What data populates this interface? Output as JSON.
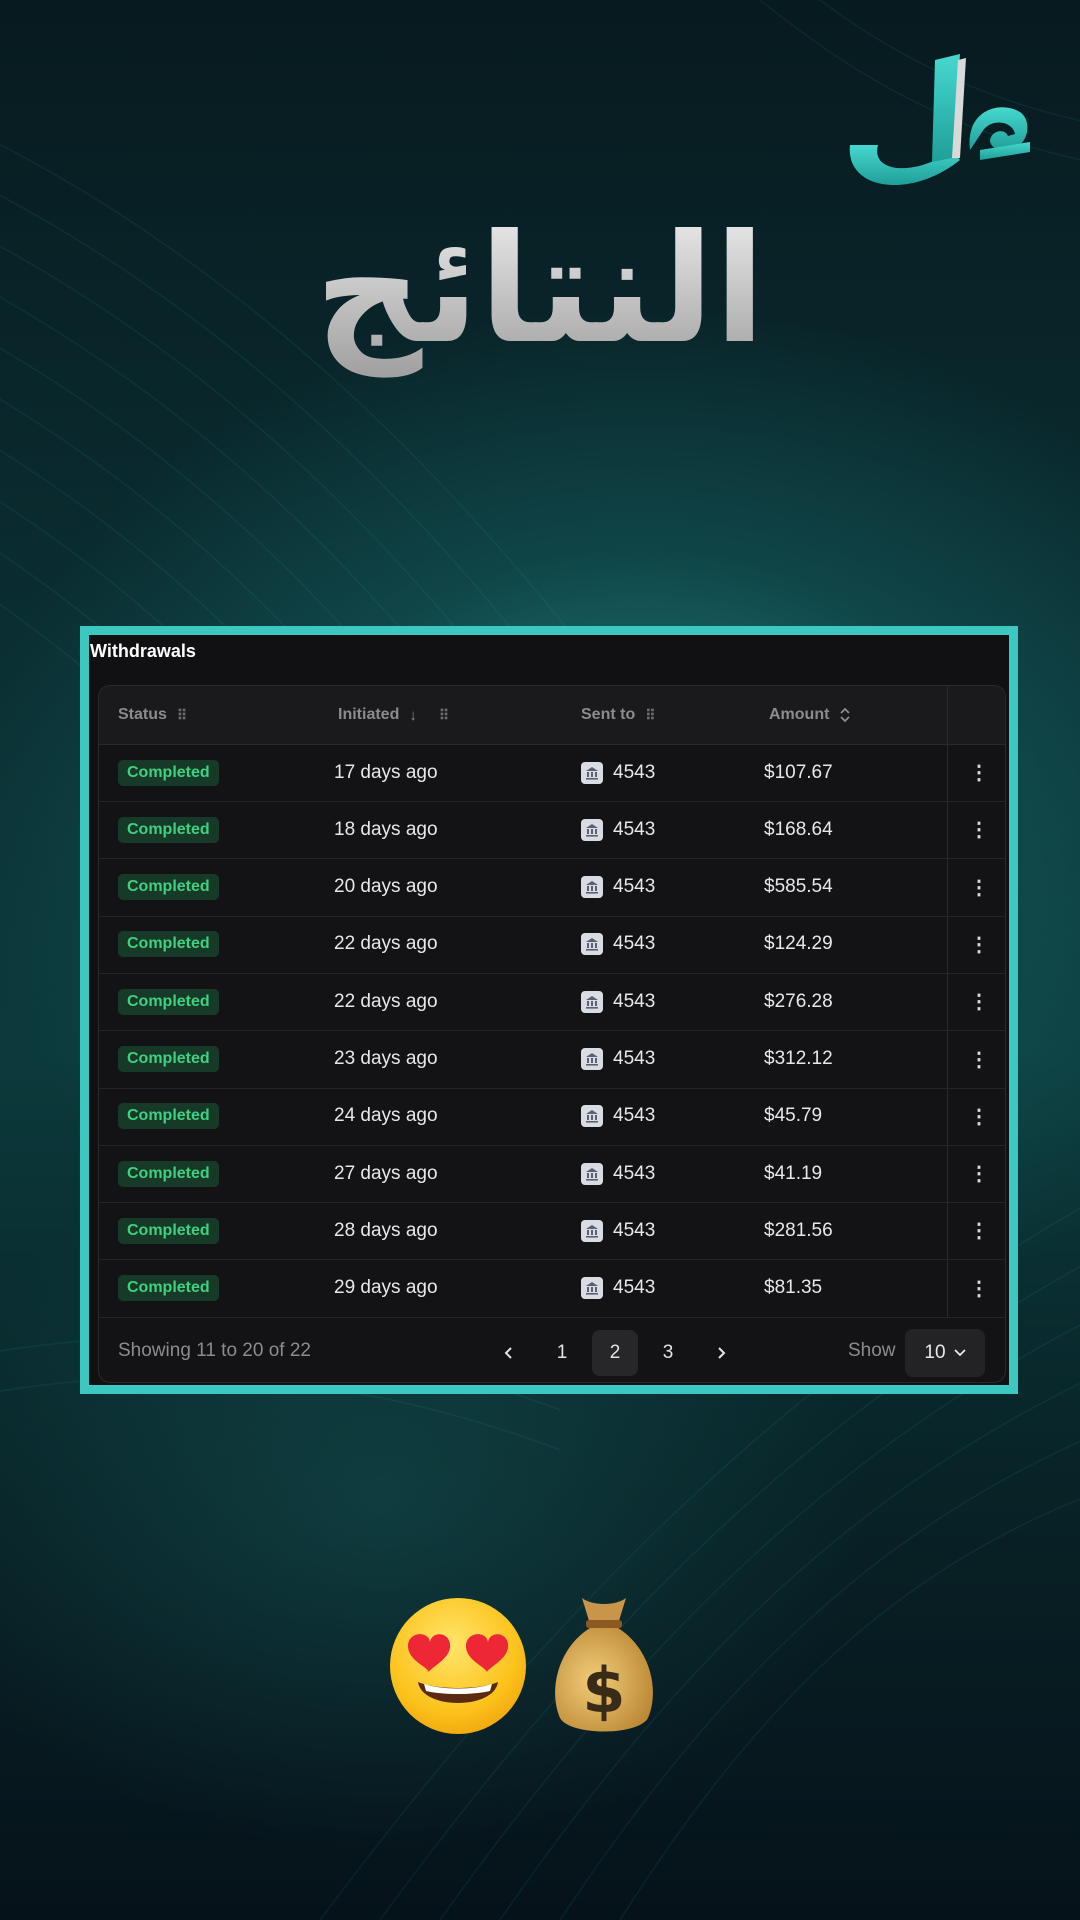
{
  "headline": "النتائج",
  "logo_text": "مال",
  "panel": {
    "title": "Withdrawals",
    "columns": [
      {
        "label": "Status",
        "indicator": "grip-icon"
      },
      {
        "label": "Initiated",
        "indicator": "arrow-down-icon"
      },
      {
        "label": "Sent to",
        "indicator": "grip-icon"
      },
      {
        "label": "Amount",
        "indicator": "sort-updown-icon"
      }
    ],
    "rows": [
      {
        "status": "Completed",
        "initiated": "17 days ago",
        "sent_to": "4543",
        "amount": "$107.67"
      },
      {
        "status": "Completed",
        "initiated": "18 days ago",
        "sent_to": "4543",
        "amount": "$168.64"
      },
      {
        "status": "Completed",
        "initiated": "20 days ago",
        "sent_to": "4543",
        "amount": "$585.54"
      },
      {
        "status": "Completed",
        "initiated": "22 days ago",
        "sent_to": "4543",
        "amount": "$124.29"
      },
      {
        "status": "Completed",
        "initiated": "22 days ago",
        "sent_to": "4543",
        "amount": "$276.28"
      },
      {
        "status": "Completed",
        "initiated": "23 days ago",
        "sent_to": "4543",
        "amount": "$312.12"
      },
      {
        "status": "Completed",
        "initiated": "24 days ago",
        "sent_to": "4543",
        "amount": "$45.79"
      },
      {
        "status": "Completed",
        "initiated": "27 days ago",
        "sent_to": "4543",
        "amount": "$41.19"
      },
      {
        "status": "Completed",
        "initiated": "28 days ago",
        "sent_to": "4543",
        "amount": "$281.56"
      },
      {
        "status": "Completed",
        "initiated": "29 days ago",
        "sent_to": "4543",
        "amount": "$81.35"
      }
    ],
    "pagination": {
      "summary": "Showing 11 to 20 of 22",
      "pages": [
        "1",
        "2",
        "3"
      ],
      "current_page": "2",
      "show_label": "Show",
      "page_size": "10"
    }
  },
  "colors": {
    "accent": "#3cc8c0",
    "badge_bg": "#173a28",
    "badge_text": "#3ed17f",
    "panel_bg": "#111113"
  },
  "emojis": [
    "smiling-face-with-heart-eyes",
    "money-bag"
  ]
}
